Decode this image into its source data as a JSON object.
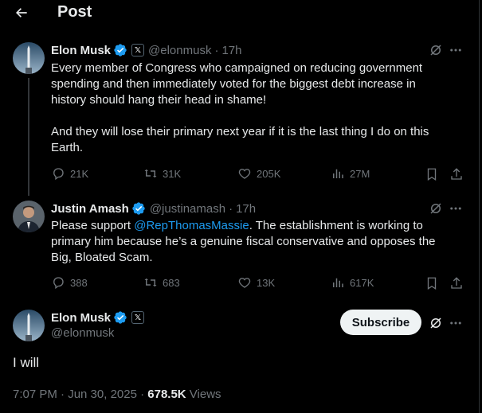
{
  "header": {
    "title": "Post"
  },
  "replies": [
    {
      "name": "Elon Musk",
      "handle": "@elonmusk",
      "time": "17h",
      "text": "Every member of Congress who campaigned on reducing government spending and then immediately voted for the biggest debt increase in history should hang their head in shame!\n\nAnd they will lose their primary next year if it is the last thing I do on this Earth.",
      "stats": {
        "replies": "21K",
        "reposts": "31K",
        "likes": "205K",
        "views": "27M"
      }
    },
    {
      "name": "Justin Amash",
      "handle": "@justinamash",
      "time": "17h",
      "text_before": "Please support ",
      "mention": "@RepThomasMassie",
      "text_after": ". The establishment is working to primary him because he’s a genuine fiscal conservative and opposes the Big, Bloated Scam.",
      "stats": {
        "replies": "388",
        "reposts": "683",
        "likes": "13K",
        "views": "617K"
      }
    }
  ],
  "main_post": {
    "name": "Elon Musk",
    "handle": "@elonmusk",
    "subscribe_label": "Subscribe",
    "text": "I will",
    "timestamp": "7:07 PM · Jun 30, 2025 · ",
    "views_count": "678.5K",
    "views_label": " Views"
  },
  "icons": [
    "back-arrow-icon",
    "verified-icon",
    "x-affiliate-icon",
    "grok-icon",
    "more-icon",
    "reply-icon",
    "repost-icon",
    "like-icon",
    "views-icon",
    "bookmark-icon",
    "share-icon"
  ],
  "colors": {
    "background": "#000000",
    "text": "#e7e9ea",
    "secondary": "#71767b",
    "accent": "#1d9bf0",
    "verified": "#1d9bf0",
    "divider": "#2f3336"
  }
}
